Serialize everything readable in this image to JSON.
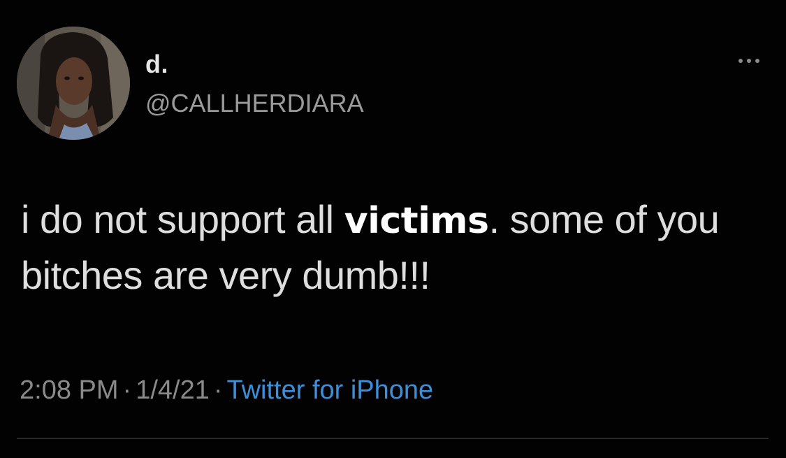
{
  "tweet": {
    "display_name": "d.",
    "handle": "@CALLHERDIARA",
    "text_before": "i do not support all ",
    "text_highlight": "victims",
    "text_after": ". some of you bitches are very dumb!!!",
    "time": "2:08 PM",
    "date": "1/4/21",
    "separator": "·",
    "source": "Twitter for iPhone",
    "more_icon": "more-horizontal-icon"
  },
  "colors": {
    "background": "#020202",
    "text": "#dedede",
    "muted": "#8a8a8a",
    "link": "#3d8fd9",
    "highlight_text": "#ffffff"
  }
}
